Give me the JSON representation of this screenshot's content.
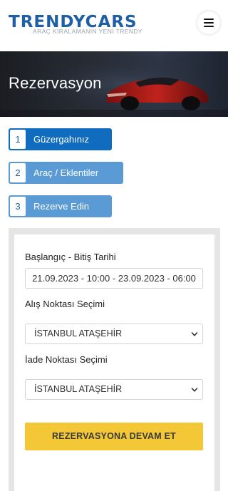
{
  "header": {
    "logo_main": "TRENDYCARS",
    "logo_tagline": "ARAÇ KİRALAMANIN YENİ TRENDY",
    "menu_icon": "hamburger-menu-icon"
  },
  "hero": {
    "title": "Rezervasyon"
  },
  "steps": [
    {
      "number": "1",
      "label": "Güzergahınız",
      "active": true
    },
    {
      "number": "2",
      "label": "Araç / Eklentiler",
      "active": false
    },
    {
      "number": "3",
      "label": "Rezerve Edin",
      "active": false
    }
  ],
  "form": {
    "date_label": "Başlangıç - Bitiş Tarihi",
    "date_value": "21.09.2023 - 10:00 - 23.09.2023 - 06:00",
    "pickup_label": "Alış Noktası Seçimi",
    "pickup_value": "İSTANBUL ATAŞEHİR",
    "return_label": "İade Noktası Seçimi",
    "return_value": "İSTANBUL ATAŞEHİR",
    "submit_label": "REZERVASYONA DEVAM ET"
  },
  "colors": {
    "brand_blue": "#1f5fa6",
    "step_active": "#0f6cbf",
    "step_inactive": "#5a9bd5",
    "cta_yellow": "#f3c735"
  }
}
